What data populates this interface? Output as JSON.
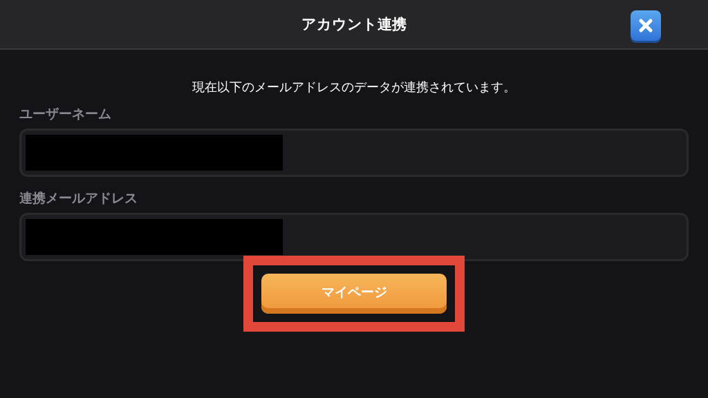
{
  "window": {
    "title": "アカウント連携"
  },
  "message": "現在以下のメールアドレスのデータが連携されています。",
  "fields": [
    {
      "label": "ユーザーネーム",
      "redacted": true
    },
    {
      "label": "連携メールアドレス",
      "redacted": true
    }
  ],
  "button": {
    "label": "マイページ",
    "highlighted": true
  }
}
